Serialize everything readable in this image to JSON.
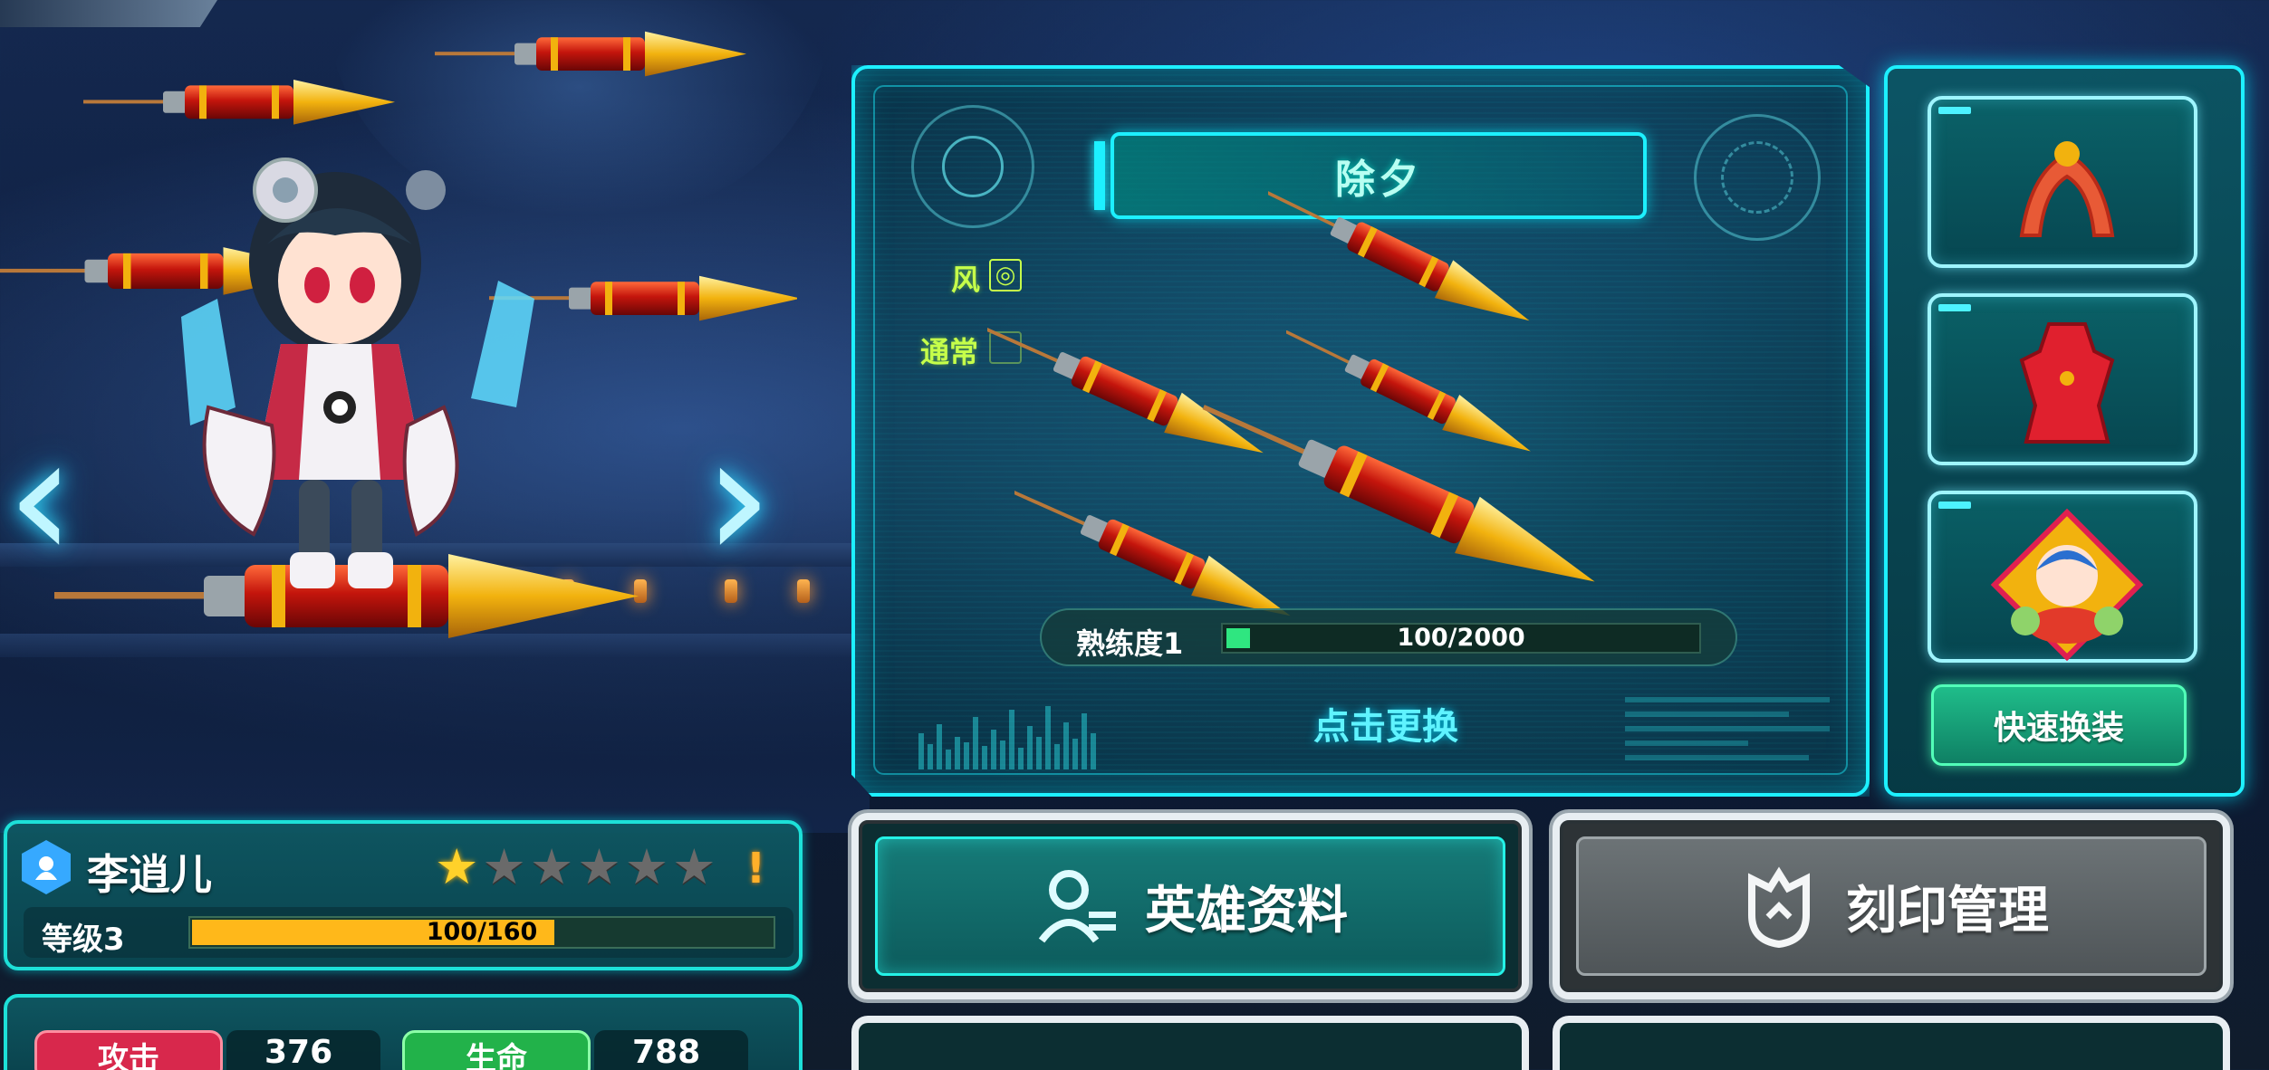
{
  "weapon": {
    "name": "除夕",
    "attribute": "风",
    "attack_type": "通常",
    "proficiency_label": "熟练度1",
    "proficiency_progress": "100/2000",
    "proficiency_fraction": 0.05,
    "change_label": "点击更换"
  },
  "equipment": {
    "slots": [
      {
        "icon": "ribbon-scroll-icon"
      },
      {
        "icon": "red-dress-icon"
      },
      {
        "icon": "character-portrait-icon"
      }
    ],
    "quick_equip_label": "快速换装"
  },
  "hero": {
    "name": "李逍儿",
    "stars_filled": 1,
    "stars_total": 6,
    "warning": "!",
    "level_label": "等级3",
    "exp_progress": "100/160",
    "exp_fraction": 0.625
  },
  "stats": {
    "attack_label": "攻击",
    "attack_value": "376",
    "hp_label": "生命",
    "hp_value": "788"
  },
  "buttons": {
    "hero_info": "英雄资料",
    "imprint_manage": "刻印管理"
  },
  "colors": {
    "accent_cyan": "#1df0ff",
    "attribute_green": "#c6ff4a",
    "exp_fill": "#ffb81a",
    "proficiency_fill": "#2fe680",
    "attack_tag": "#d8284c",
    "hp_tag": "#22b24a"
  }
}
